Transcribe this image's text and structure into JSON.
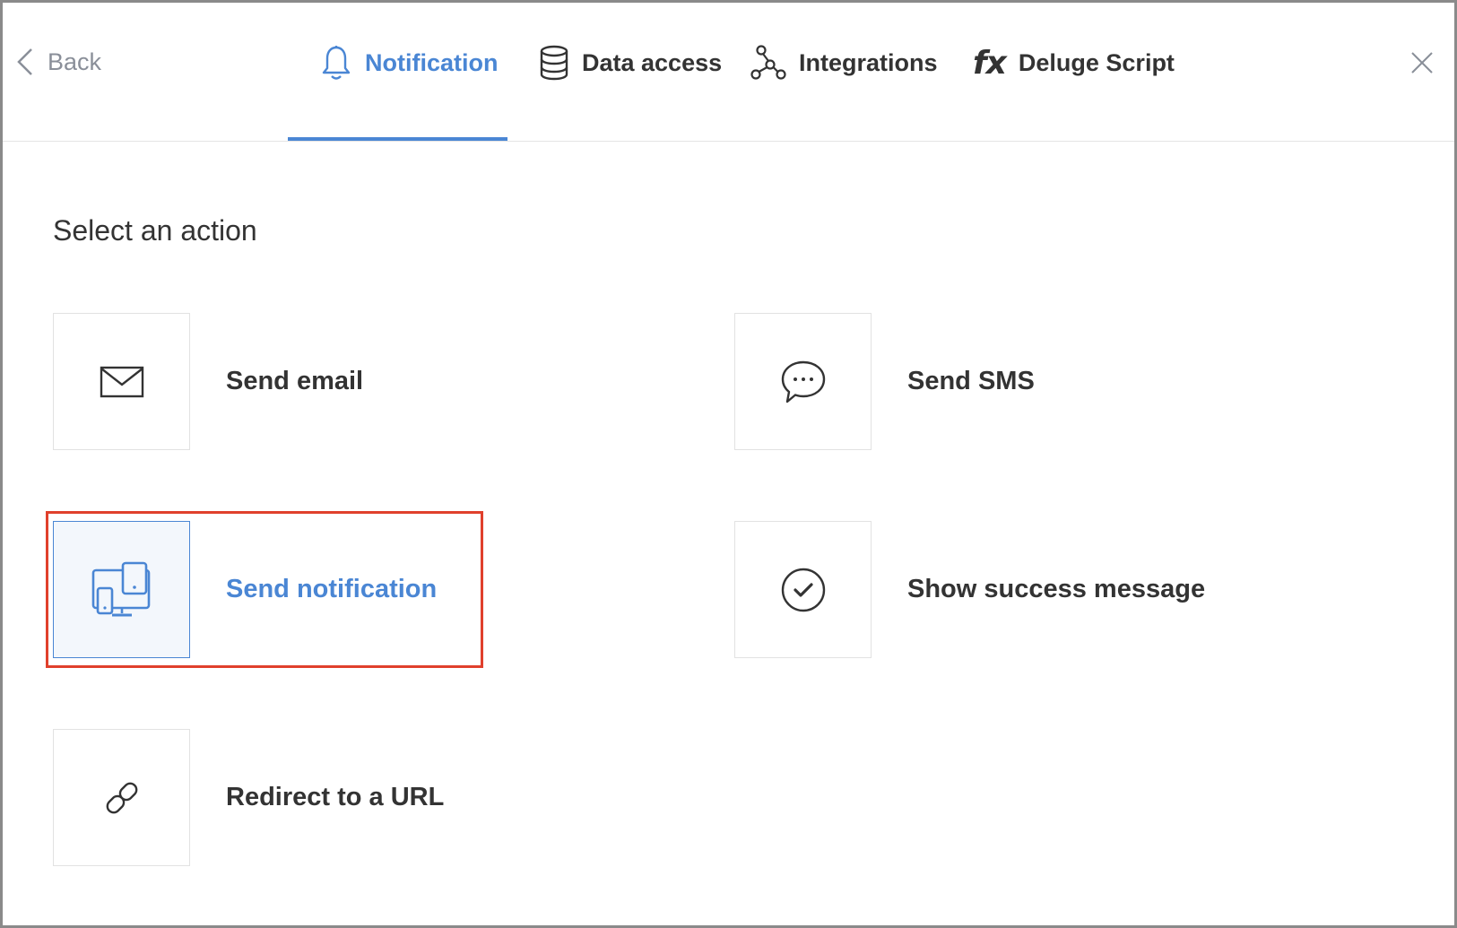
{
  "header": {
    "back_label": "Back",
    "tabs": [
      {
        "label": "Notification",
        "icon": "bell-icon",
        "active": true
      },
      {
        "label": "Data access",
        "icon": "database-icon",
        "active": false
      },
      {
        "label": "Integrations",
        "icon": "integrations-icon",
        "active": false
      },
      {
        "label": "Deluge Script",
        "icon": "fx-icon",
        "active": false
      }
    ],
    "fx_glyph": "fx"
  },
  "main": {
    "title": "Select an action",
    "actions": [
      {
        "label": "Send email",
        "icon": "envelope-icon"
      },
      {
        "label": "Send SMS",
        "icon": "chat-bubble-icon"
      },
      {
        "label": "Send notification",
        "icon": "devices-icon",
        "selected": true
      },
      {
        "label": "Show success message",
        "icon": "check-circle-icon"
      },
      {
        "label": "Redirect to a URL",
        "icon": "link-icon"
      }
    ]
  },
  "colors": {
    "accent": "#4a86d4",
    "highlight": "#e0402c",
    "text": "#333333"
  }
}
